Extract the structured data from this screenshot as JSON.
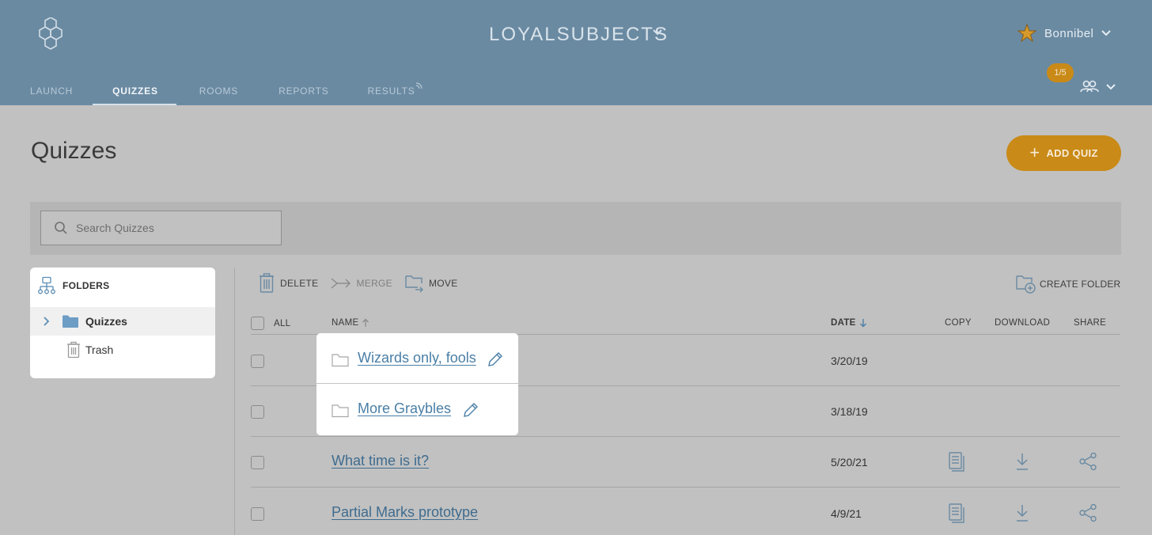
{
  "header": {
    "brand": "LOYALSUBJECTS",
    "user_name": "Bonnibel",
    "badge": "1/5",
    "nav": [
      {
        "label": "LAUNCH"
      },
      {
        "label": "QUIZZES"
      },
      {
        "label": "ROOMS"
      },
      {
        "label": "REPORTS"
      },
      {
        "label": "RESULTS"
      }
    ],
    "active_nav": "QUIZZES"
  },
  "page": {
    "title": "Quizzes",
    "add_quiz": "ADD QUIZ",
    "search_placeholder": "Search Quizzes"
  },
  "folders": {
    "heading": "FOLDERS",
    "items": [
      {
        "label": "Quizzes",
        "selected": true
      },
      {
        "label": "Trash",
        "selected": false
      }
    ]
  },
  "toolbar": {
    "delete": "DELETE",
    "merge": "MERGE",
    "move": "MOVE",
    "create_folder": "CREATE FOLDER"
  },
  "table": {
    "headers": {
      "all": "ALL",
      "name": "NAME",
      "date": "DATE",
      "copy": "COPY",
      "download": "DOWNLOAD",
      "share": "SHARE"
    },
    "rows": [
      {
        "name": "Wizards only, fools",
        "date": "3/20/19",
        "type": "folder"
      },
      {
        "name": "More Graybles",
        "date": "3/18/19",
        "type": "folder"
      },
      {
        "name": "What time is it?",
        "date": "5/20/21",
        "type": "quiz"
      },
      {
        "name": "Partial Marks prototype",
        "date": "4/9/21",
        "type": "quiz"
      }
    ]
  },
  "colors": {
    "header_bg": "#6a8aa2",
    "accent": "#c98a17",
    "link": "#3f6c8f",
    "overlay_bg": "#c1c1c1"
  }
}
